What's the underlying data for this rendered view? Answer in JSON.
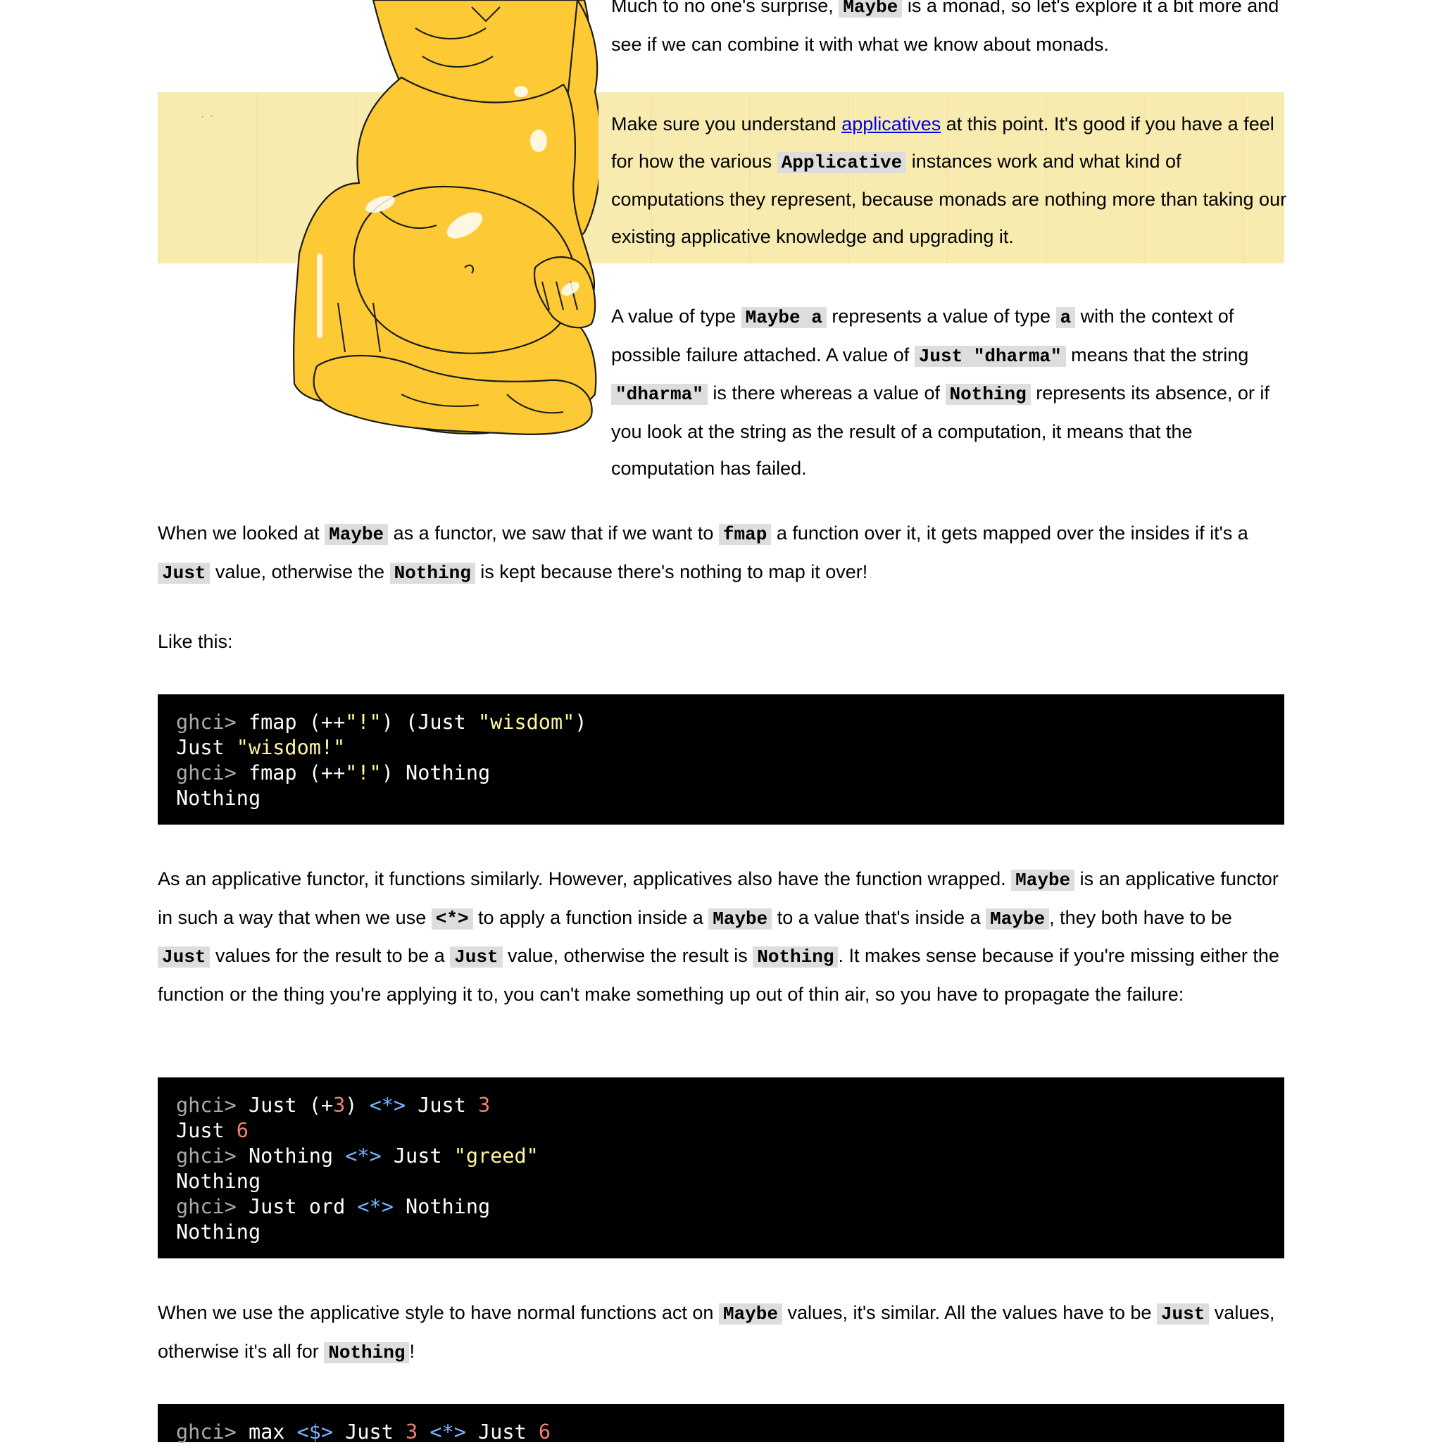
{
  "intro": {
    "p1_a": "Much to no one's surprise, ",
    "p1_code": "Maybe",
    "p1_b": " is a monad, so let's explore it a bit more and see if we can combine it with what we know about monads.",
    "p2_a": "Make sure you understand ",
    "p2_link": "applicatives",
    "p2_b": " at this point. It's good if you have a feel for how the various ",
    "p2_code": "Applicative",
    "p2_c": " instances work and what kind of computations they represent, because monads are nothing more than taking our existing applicative knowledge and upgrading it.",
    "p3_a": "A value of type ",
    "p3_code1": "Maybe a",
    "p3_b": " represents a value of type ",
    "p3_code2": "a",
    "p3_c": " with the context of possible failure attached. A value of ",
    "p3_code3": "Just \"dharma\"",
    "p3_d": " means that the string ",
    "p3_code4": "\"dharma\"",
    "p3_e": " is there whereas a value of ",
    "p3_code5": "Nothing",
    "p3_f": " represents its absence, or if you look at the string as the result of a computation, it means that the computation has failed."
  },
  "functor": {
    "a": "When we looked at ",
    "c1": "Maybe",
    "b": " as a functor, we saw that if we want to ",
    "c2": "fmap",
    "c": " a function over it, it gets mapped over the insides if it's a ",
    "c3": "Just",
    "d": " value, otherwise the ",
    "c4": "Nothing",
    "e": " is kept because there's nothing to map it over!"
  },
  "like_this": "Like this:",
  "code1": {
    "prompt": "ghci>",
    "l1_a": " fmap (++",
    "l1_s1": "\"!\"",
    "l1_b": ") (Just ",
    "l1_s2": "\"wisdom\"",
    "l1_c": ")",
    "l2_a": "Just ",
    "l2_s": "\"wisdom!\"",
    "l3_a": " fmap (++",
    "l3_s": "\"!\"",
    "l3_b": ") Nothing",
    "l4": "Nothing"
  },
  "applicative": {
    "a": "As an applicative functor, it functions similarly. However, applicatives also have the function wrapped. ",
    "c1": "Maybe",
    "b": " is an applicative functor in such a way that when we use ",
    "c2": "<*>",
    "c": " to apply a function inside a ",
    "c3": "Maybe",
    "d": " to a value that's inside a ",
    "c4": "Maybe",
    "e": ", they both have to be ",
    "c5": "Just",
    "f": " values for the result to be a ",
    "c6": "Just",
    "g": " value, otherwise the result is ",
    "c7": "Nothing",
    "h": ". It makes sense because if you're missing either the function or the thing you're applying it to, you can't make something up out of thin air, so you have to propagate the failure:"
  },
  "code2": {
    "prompt": "ghci>",
    "l1_a": " Just (+",
    "l1_n1": "3",
    "l1_b": ") ",
    "l1_op": "<*>",
    "l1_c": " Just ",
    "l1_n2": "3",
    "l2_a": "Just ",
    "l2_n": "6",
    "l3_a": " Nothing ",
    "l3_op": "<*>",
    "l3_b": " Just ",
    "l3_s": "\"greed\"",
    "l4": "Nothing",
    "l5_a": " Just ord ",
    "l5_op": "<*>",
    "l5_b": " Nothing",
    "l6": "Nothing"
  },
  "style_para": {
    "a": "When we use the applicative style to have normal functions act on ",
    "c1": "Maybe",
    "b": " values, it's similar. All the values have to be ",
    "c2": "Just",
    "c": " values, otherwise it's all for ",
    "c3": "Nothing",
    "d": "!"
  },
  "code3": {
    "prompt": "ghci>",
    "l1_a": " max ",
    "l1_op1": "<$>",
    "l1_b": " Just ",
    "l1_n1": "3",
    "l1_c": " ",
    "l1_op2": "<*>",
    "l1_d": " Just ",
    "l1_n2": "6"
  },
  "colors": {
    "code_bg": "#000000",
    "string": "#fff799",
    "number": "#f08070",
    "operator": "#7bb3ff",
    "prompt": "#aaaaaa",
    "inline_code_bg": "#dddddd",
    "band": "#f8ebb0",
    "buddha": "#fdc934"
  },
  "icons": {
    "illustration": "laughing-buddha-illustration"
  }
}
